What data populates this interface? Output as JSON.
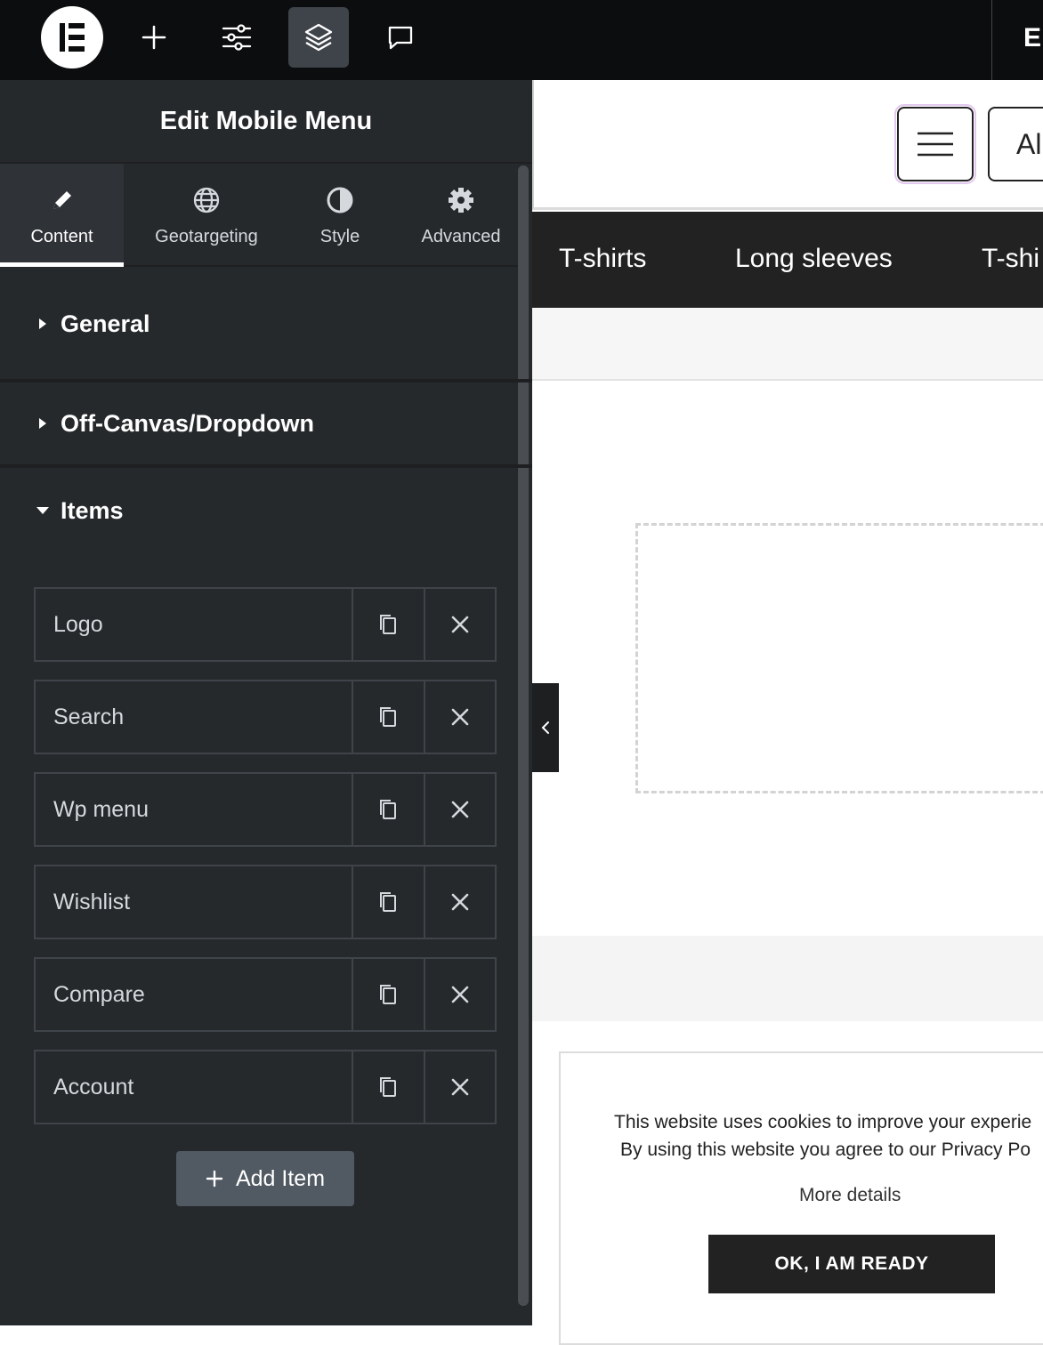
{
  "topbar": {
    "right_text": "El",
    "icons": [
      "elementor-logo-icon",
      "plus-icon",
      "sliders-icon",
      "layers-icon",
      "chat-icon"
    ]
  },
  "panel": {
    "title": "Edit Mobile Menu",
    "tabs": [
      {
        "label": "Content",
        "icon": "pencil-icon",
        "active": true
      },
      {
        "label": "Geotargeting",
        "icon": "globe-icon",
        "active": false
      },
      {
        "label": "Style",
        "icon": "half-circle-icon",
        "active": false
      },
      {
        "label": "Advanced",
        "icon": "gear-icon",
        "active": false
      }
    ],
    "sections": [
      {
        "label": "General",
        "expanded": false
      },
      {
        "label": "Off-Canvas/Dropdown",
        "expanded": false
      },
      {
        "label": "Items",
        "expanded": true
      }
    ],
    "items": [
      {
        "label": "Logo"
      },
      {
        "label": "Search"
      },
      {
        "label": "Wp menu"
      },
      {
        "label": "Wishlist"
      },
      {
        "label": "Compare"
      },
      {
        "label": "Account"
      }
    ],
    "add_item_label": "Add Item"
  },
  "canvas": {
    "all_button_text": "All",
    "categories": [
      "T-shirts",
      "Long sleeves",
      "T-shi"
    ],
    "cookie": {
      "line1": "This website uses cookies to improve your experie",
      "line2_prefix": "By using this website you agree to our ",
      "line2_link": "Privacy Po",
      "more_details": "More details",
      "ok_button": "OK, I AM READY"
    }
  }
}
